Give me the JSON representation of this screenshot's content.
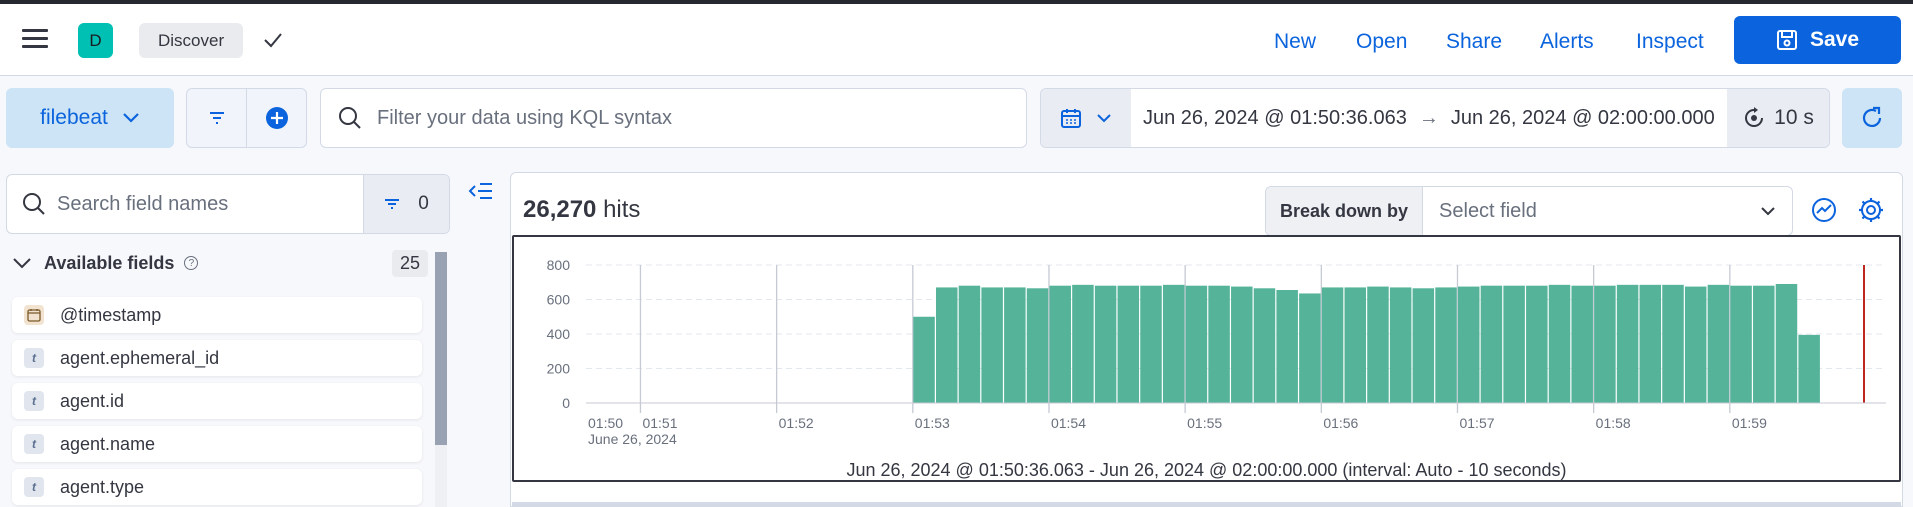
{
  "header": {
    "avatar_letter": "D",
    "breadcrumb": "Discover",
    "nav": [
      "New",
      "Open",
      "Share",
      "Alerts",
      "Inspect"
    ],
    "save_label": "Save"
  },
  "query_bar": {
    "data_view": "filebeat",
    "search_placeholder": "Filter your data using KQL syntax",
    "time_start": "Jun 26, 2024 @ 01:50:36.063",
    "time_arrow": "→",
    "time_end": "Jun 26, 2024 @ 02:00:00.000",
    "refresh_interval": "10 s"
  },
  "sidebar": {
    "search_placeholder": "Search field names",
    "filter_count": "0",
    "available_title": "Available fields",
    "available_count": "25",
    "fields": [
      {
        "name": "@timestamp",
        "type": "date"
      },
      {
        "name": "agent.ephemeral_id",
        "type": "t"
      },
      {
        "name": "agent.id",
        "type": "t"
      },
      {
        "name": "agent.name",
        "type": "t"
      },
      {
        "name": "agent.type",
        "type": "t"
      }
    ]
  },
  "results": {
    "hits_count": "26,270",
    "hits_label": "hits",
    "breakdown_label": "Break down by",
    "breakdown_placeholder": "Select field"
  },
  "chart_data": {
    "type": "bar",
    "color": "#54b399",
    "marker_color": "#bd271e",
    "y_ticks": [
      "800",
      "600",
      "400",
      "200",
      "0"
    ],
    "ylim": [
      0,
      800
    ],
    "x_ticks": [
      "01:50",
      "01:51",
      "01:52",
      "01:53",
      "01:54",
      "01:55",
      "01:56",
      "01:57",
      "01:58",
      "01:59"
    ],
    "x_sublabel": "June 26, 2024",
    "x_start_seconds": 3036,
    "x_end_seconds": 3600,
    "interval_seconds": 10,
    "bars": [
      {
        "t": 3180,
        "v": 500
      },
      {
        "t": 3190,
        "v": 670
      },
      {
        "t": 3200,
        "v": 680
      },
      {
        "t": 3210,
        "v": 670
      },
      {
        "t": 3220,
        "v": 670
      },
      {
        "t": 3230,
        "v": 665
      },
      {
        "t": 3240,
        "v": 680
      },
      {
        "t": 3250,
        "v": 685
      },
      {
        "t": 3260,
        "v": 680
      },
      {
        "t": 3270,
        "v": 680
      },
      {
        "t": 3280,
        "v": 680
      },
      {
        "t": 3290,
        "v": 685
      },
      {
        "t": 3300,
        "v": 680
      },
      {
        "t": 3310,
        "v": 680
      },
      {
        "t": 3320,
        "v": 675
      },
      {
        "t": 3330,
        "v": 665
      },
      {
        "t": 3340,
        "v": 655
      },
      {
        "t": 3350,
        "v": 635
      },
      {
        "t": 3360,
        "v": 670
      },
      {
        "t": 3370,
        "v": 670
      },
      {
        "t": 3380,
        "v": 675
      },
      {
        "t": 3390,
        "v": 670
      },
      {
        "t": 3400,
        "v": 665
      },
      {
        "t": 3410,
        "v": 670
      },
      {
        "t": 3420,
        "v": 675
      },
      {
        "t": 3430,
        "v": 680
      },
      {
        "t": 3440,
        "v": 680
      },
      {
        "t": 3450,
        "v": 680
      },
      {
        "t": 3460,
        "v": 685
      },
      {
        "t": 3470,
        "v": 680
      },
      {
        "t": 3480,
        "v": 680
      },
      {
        "t": 3490,
        "v": 685
      },
      {
        "t": 3500,
        "v": 685
      },
      {
        "t": 3510,
        "v": 685
      },
      {
        "t": 3520,
        "v": 675
      },
      {
        "t": 3530,
        "v": 685
      },
      {
        "t": 3540,
        "v": 680
      },
      {
        "t": 3550,
        "v": 680
      },
      {
        "t": 3560,
        "v": 690
      },
      {
        "t": 3570,
        "v": 395
      }
    ],
    "caption": "Jun 26, 2024 @ 01:50:36.063 - Jun 26, 2024 @ 02:00:00.000 (interval: Auto - 10 seconds)"
  }
}
